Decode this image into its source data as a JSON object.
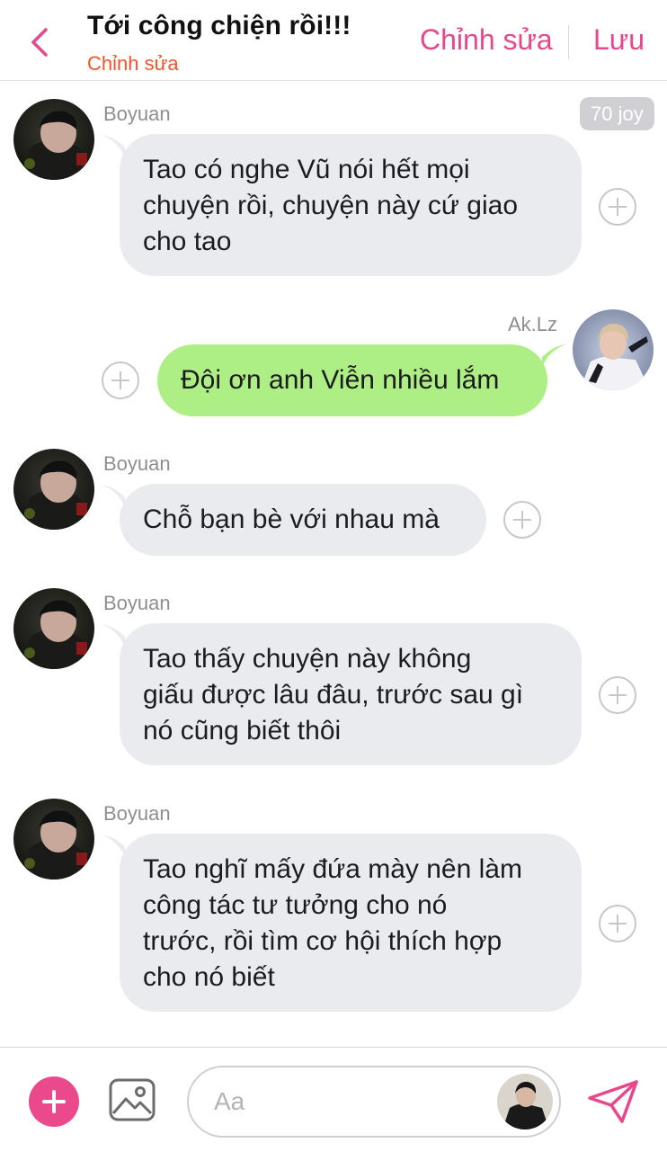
{
  "header": {
    "title": "Tới công chiện rồi!!!",
    "subtitle": "Chỉnh sửa",
    "edit_label": "Chỉnh sửa",
    "save_label": "Lưu"
  },
  "messages": [
    {
      "sender": "Boyuan",
      "direction": "incoming",
      "lines": [
        "Tao có nghe Vũ nói hết mọi",
        "chuyện rồi, chuyện này cứ giao",
        "cho tao"
      ]
    },
    {
      "sender": "Ak.Lz",
      "direction": "outgoing",
      "lines": [
        "Đội ơn anh Viễn nhiều lắm"
      ]
    },
    {
      "sender": "Boyuan",
      "direction": "incoming",
      "lines": [
        "Chỗ bạn bè với nhau mà"
      ]
    },
    {
      "sender": "Boyuan",
      "direction": "incoming",
      "lines": [
        "Tao thấy chuyện này không",
        "giấu được lâu đâu, trước sau gì",
        "nó cũng biết thôi"
      ]
    },
    {
      "sender": "Boyuan",
      "direction": "incoming",
      "lines": [
        "Tao nghĩ mấy đứa mày nên làm",
        "công tác tư tưởng cho nó",
        "trước, rồi tìm cơ hội thích hợp",
        "cho nó biết"
      ]
    }
  ],
  "joy_badge": "70 joy",
  "composer": {
    "placeholder": "Aa"
  },
  "icons": {
    "back": "chevron-left-icon",
    "add": "plus-icon",
    "image": "image-icon",
    "send": "send-icon",
    "message_action": "plus-circle-icon"
  },
  "colors": {
    "accent_pink": "#e7488b",
    "subtitle_orange": "#f2542d",
    "incoming_bubble": "#e9ebee",
    "outgoing_bubble": "#aeef85"
  }
}
